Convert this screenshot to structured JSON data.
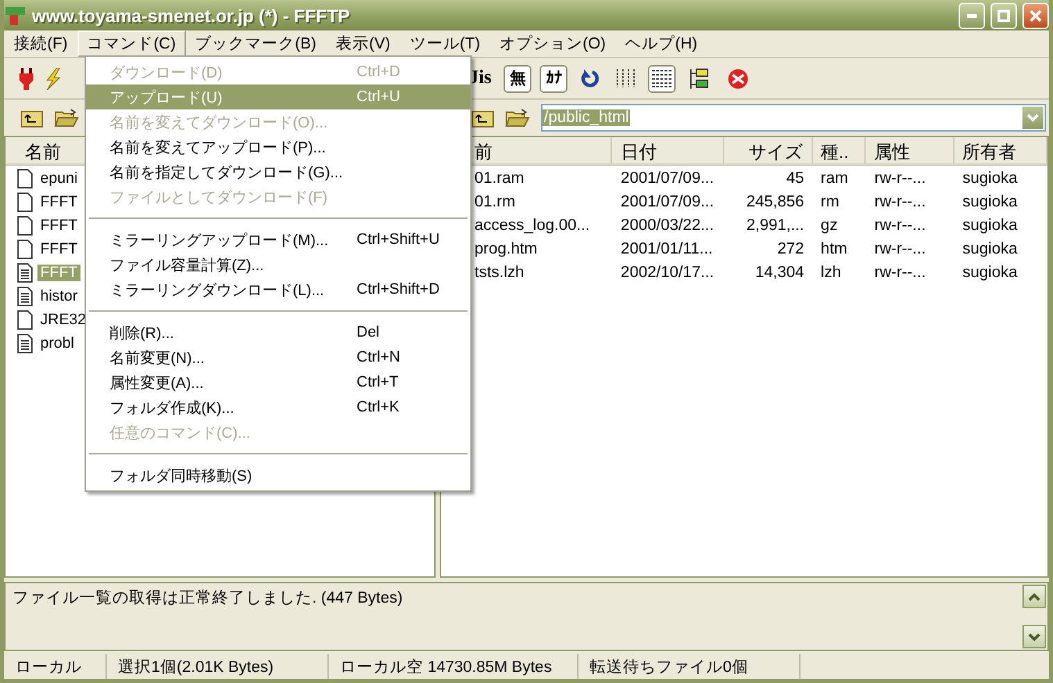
{
  "window": {
    "title": "www.toyama-smenet.or.jp (*) - FFFTP"
  },
  "menubar": [
    {
      "label": "接続(F)",
      "selected": false
    },
    {
      "label": "コマンド(C)",
      "selected": true
    },
    {
      "label": "ブックマーク(B)",
      "selected": false
    },
    {
      "label": "表示(V)",
      "selected": false
    },
    {
      "label": "ツール(T)",
      "selected": false
    },
    {
      "label": "オプション(O)",
      "selected": false
    },
    {
      "label": "ヘルプ(H)",
      "selected": false
    }
  ],
  "toolbar": [
    {
      "kind": "jis",
      "label": "Jis",
      "pressed": false
    },
    {
      "kind": "text",
      "label": "無",
      "pressed": true
    },
    {
      "kind": "text",
      "label": "ｶﾅ",
      "pressed": true
    },
    {
      "kind": "refresh",
      "pressed": false
    },
    {
      "kind": "list",
      "pressed": false
    },
    {
      "kind": "details",
      "pressed": true
    },
    {
      "kind": "tree",
      "pressed": false
    },
    {
      "kind": "stop",
      "pressed": false
    }
  ],
  "remote_path": {
    "value": "/public_html"
  },
  "local_pane": {
    "columns": [
      "名前"
    ],
    "rows": [
      {
        "name": "epuni",
        "kind": "blank",
        "selected": false
      },
      {
        "name": "FFFT",
        "kind": "blank",
        "selected": false
      },
      {
        "name": "FFFT",
        "kind": "blank",
        "selected": false
      },
      {
        "name": "FFFT",
        "kind": "blank",
        "selected": false
      },
      {
        "name": "FFFT",
        "kind": "text",
        "selected": true
      },
      {
        "name": "histor",
        "kind": "text",
        "selected": false
      },
      {
        "name": "JRE32",
        "kind": "blank",
        "selected": false
      },
      {
        "name": "probl",
        "kind": "text",
        "selected": false
      }
    ]
  },
  "remote_pane": {
    "columns": [
      "前",
      "日付",
      "サイズ",
      "種..",
      "属性",
      "所有者"
    ],
    "rows": [
      [
        "01.ram",
        "2001/07/09...",
        "45",
        "ram",
        "rw-r--...",
        "sugioka"
      ],
      [
        "01.rm",
        "2001/07/09...",
        "245,856",
        "rm",
        "rw-r--...",
        "sugioka"
      ],
      [
        "access_log.00...",
        "2000/03/22...",
        "2,991,...",
        "gz",
        "rw-r--...",
        "sugioka"
      ],
      [
        "prog.htm",
        "2001/01/11...",
        "272",
        "htm",
        "rw-r--...",
        "sugioka"
      ],
      [
        "tsts.lzh",
        "2002/10/17...",
        "14,304",
        "lzh",
        "rw-r--...",
        "sugioka"
      ]
    ]
  },
  "command_menu": [
    {
      "kind": "item",
      "label": "ダウンロード(D)",
      "shortcut": "Ctrl+D",
      "disabled": true,
      "selected": false
    },
    {
      "kind": "item",
      "label": "アップロード(U)",
      "shortcut": "Ctrl+U",
      "disabled": false,
      "selected": true
    },
    {
      "kind": "item",
      "label": "名前を変えてダウンロード(O)...",
      "disabled": true,
      "selected": false
    },
    {
      "kind": "item",
      "label": "名前を変えてアップロード(P)...",
      "disabled": false,
      "selected": false
    },
    {
      "kind": "item",
      "label": "名前を指定してダウンロード(G)...",
      "disabled": false,
      "selected": false
    },
    {
      "kind": "item",
      "label": "ファイルとしてダウンロード(F)",
      "disabled": true,
      "selected": false
    },
    {
      "kind": "separator"
    },
    {
      "kind": "item",
      "label": "ミラーリングアップロード(M)...",
      "shortcut": "Ctrl+Shift+U",
      "disabled": false,
      "selected": false
    },
    {
      "kind": "item",
      "label": "ファイル容量計算(Z)...",
      "disabled": false,
      "selected": false
    },
    {
      "kind": "item",
      "label": "ミラーリングダウンロード(L)...",
      "shortcut": "Ctrl+Shift+D",
      "disabled": false,
      "selected": false
    },
    {
      "kind": "separator"
    },
    {
      "kind": "item",
      "label": "削除(R)...",
      "shortcut": "Del",
      "disabled": false,
      "selected": false
    },
    {
      "kind": "item",
      "label": "名前変更(N)...",
      "shortcut": "Ctrl+N",
      "disabled": false,
      "selected": false
    },
    {
      "kind": "item",
      "label": "属性変更(A)...",
      "shortcut": "Ctrl+T",
      "disabled": false,
      "selected": false
    },
    {
      "kind": "item",
      "label": "フォルダ作成(K)...",
      "shortcut": "Ctrl+K",
      "disabled": false,
      "selected": false
    },
    {
      "kind": "item",
      "label": "任意のコマンド(C)...",
      "disabled": true,
      "selected": false
    },
    {
      "kind": "separator"
    },
    {
      "kind": "item",
      "label": "フォルダ同時移動(S)",
      "disabled": false,
      "selected": false
    }
  ],
  "log": {
    "message": "ファイル一覧の取得は正常終了しました. (447 Bytes)"
  },
  "status_bar": [
    "ローカル",
    "選択1個(2.01K Bytes)",
    "ローカル空 14730.85M Bytes",
    "転送待ちファイル0個"
  ]
}
